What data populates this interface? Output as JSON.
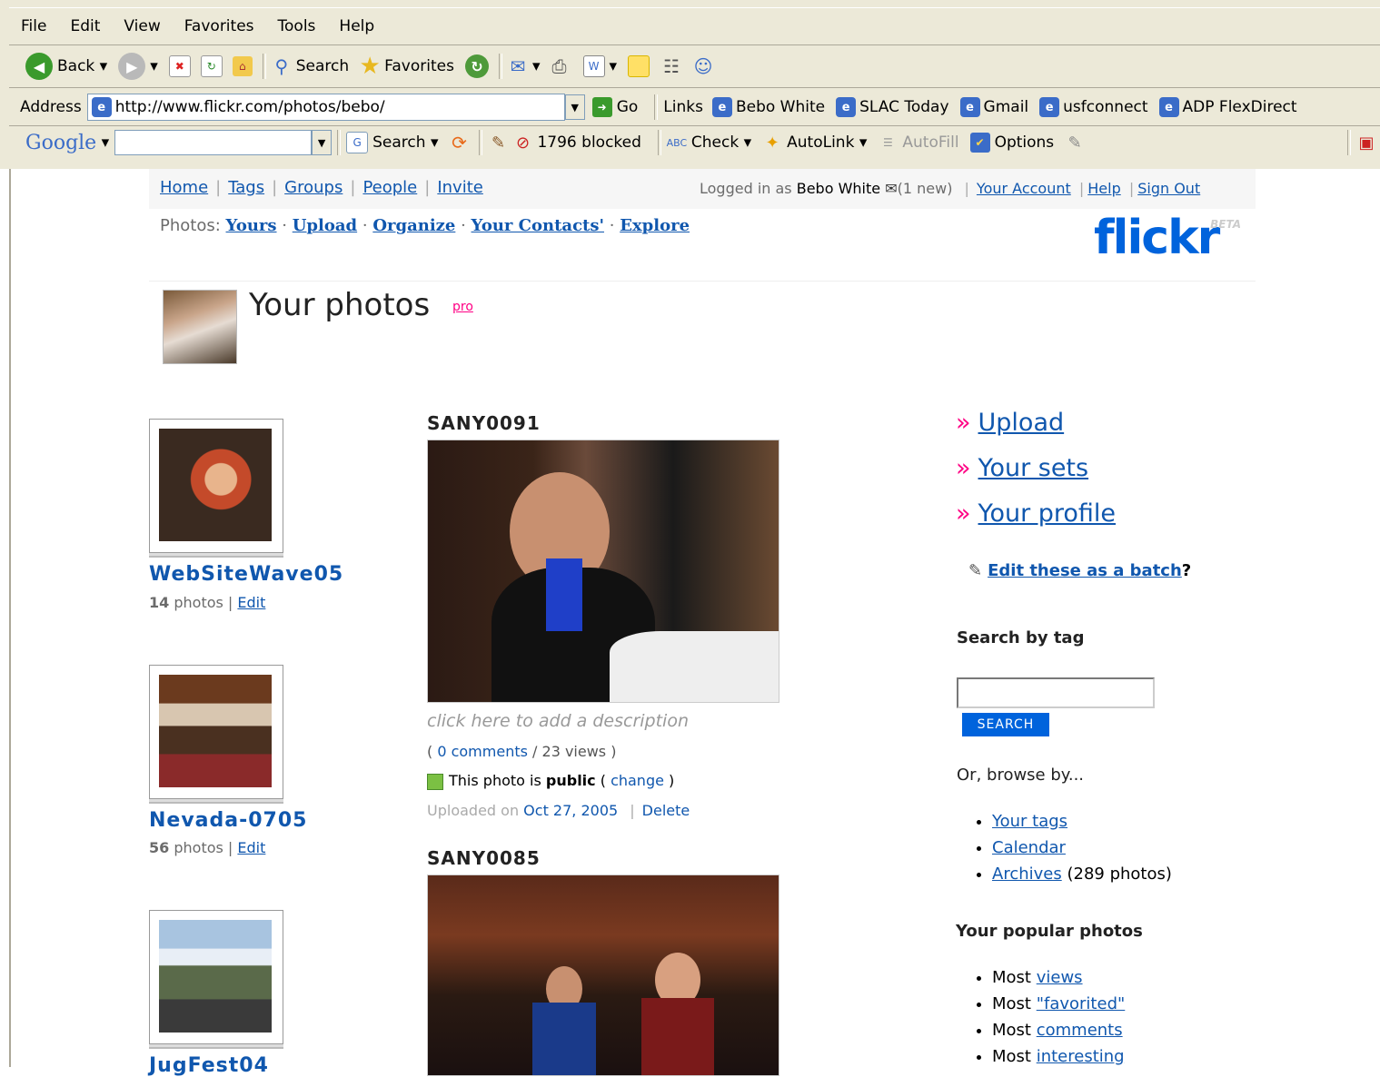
{
  "browser": {
    "menu": [
      "File",
      "Edit",
      "View",
      "Favorites",
      "Tools",
      "Help"
    ],
    "toolbar": {
      "back": "Back",
      "search": "Search",
      "favorites": "Favorites"
    },
    "address_label": "Address",
    "address_url": "http://www.flickr.com/photos/bebo/",
    "go": "Go",
    "links_label": "Links",
    "links": [
      "Bebo White",
      "SLAC Today",
      "Gmail",
      "usfconnect",
      "ADP FlexDirect"
    ],
    "google": {
      "logo": "Google",
      "search": "Search",
      "blocked": "1796 blocked",
      "check": "Check",
      "autolink": "AutoLink",
      "autofill": "AutoFill",
      "options": "Options"
    }
  },
  "nav": {
    "links": [
      "Home",
      "Tags",
      "Groups",
      "People",
      "Invite"
    ],
    "logged_in_prefix": "Logged in as",
    "user": "Bebo White",
    "new_msgs": "(1 new)",
    "account_links": [
      "Your Account",
      "Help",
      "Sign Out"
    ],
    "photos_label": "Photos:",
    "photos_links": [
      "Yours",
      "Upload",
      "Organize",
      "Your Contacts'",
      "Explore"
    ],
    "logo": "flickr",
    "logo_beta": "BETA"
  },
  "header": {
    "title": "Your photos",
    "pro": "pro"
  },
  "sets": [
    {
      "name": "WebSiteWave05",
      "count": "14",
      "photos_label": "photos",
      "edit": "Edit"
    },
    {
      "name": "Nevada-0705",
      "count": "56",
      "photos_label": "photos",
      "edit": "Edit"
    },
    {
      "name": "JugFest04",
      "count": "",
      "photos_label": "",
      "edit": ""
    }
  ],
  "photos": [
    {
      "title": "SANY0091",
      "desc_placeholder": "click here to add a description",
      "comments": "0 comments",
      "views": "23 views",
      "privacy_prefix": "This photo is",
      "privacy": "public",
      "change": "change",
      "uploaded_prefix": "Uploaded on",
      "uploaded_date": "Oct 27, 2005",
      "delete": "Delete"
    },
    {
      "title": "SANY0085"
    }
  ],
  "sidebar": {
    "links": [
      "Upload",
      "Your sets",
      "Your profile"
    ],
    "batch": "Edit these as a batch",
    "batch_q": "?",
    "search_heading": "Search by tag",
    "search_button": "SEARCH",
    "browse_heading": "Or, browse by...",
    "browse": [
      {
        "link": "Your tags",
        "extra": ""
      },
      {
        "link": "Calendar",
        "extra": ""
      },
      {
        "link": "Archives",
        "extra": "(289 photos)"
      }
    ],
    "popular_heading": "Your popular photos",
    "popular": [
      {
        "prefix": "Most",
        "link": "views"
      },
      {
        "prefix": "Most",
        "link": "\"favorited\""
      },
      {
        "prefix": "Most",
        "link": "comments"
      },
      {
        "prefix": "Most",
        "link": "interesting"
      }
    ]
  },
  "colors": {
    "link": "#1057ae",
    "pink": "#ff0084",
    "chrome": "#ece9d8"
  }
}
